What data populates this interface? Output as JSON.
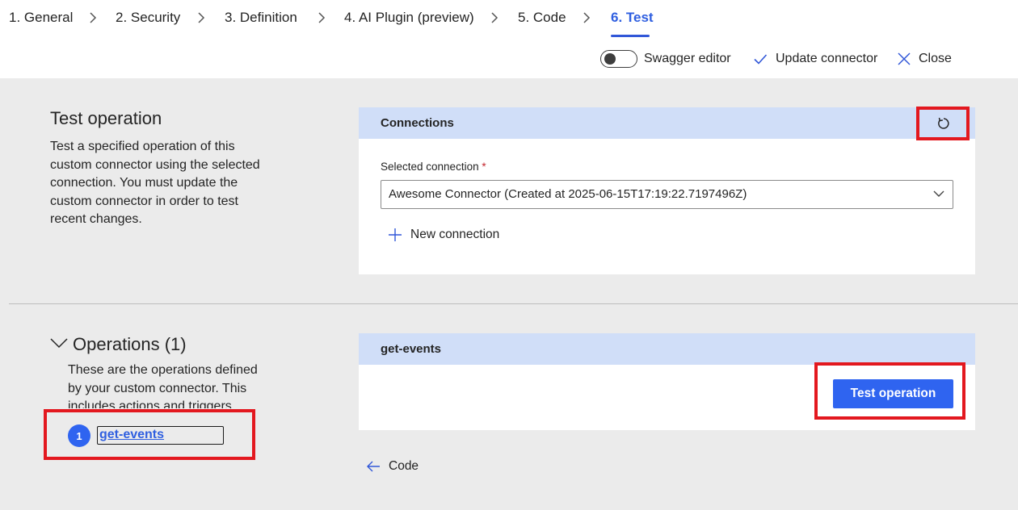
{
  "steps": [
    {
      "label": "1. General"
    },
    {
      "label": "2. Security"
    },
    {
      "label": "3. Definition"
    },
    {
      "label": "4. AI Plugin (preview)"
    },
    {
      "label": "5. Code"
    },
    {
      "label": "6. Test"
    }
  ],
  "toolbar": {
    "swagger_label": "Swagger editor",
    "update_label": "Update connector",
    "close_label": "Close"
  },
  "test_operation": {
    "title": "Test operation",
    "description": "Test a specified operation of this custom connector using the selected connection. You must update the custom connector in order to test recent changes."
  },
  "connections": {
    "header": "Connections",
    "selected_label": "Selected connection",
    "required_mark": "*",
    "selected_value": "Awesome Connector (Created at 2025-06-15T17:19:22.7197496Z)",
    "new_connection_label": "New connection"
  },
  "operations": {
    "title": "Operations (1)",
    "description": "These are the operations defined by your custom connector. This includes actions and triggers",
    "items": [
      {
        "number": "1",
        "name": "get-events"
      }
    ]
  },
  "operation_panel": {
    "header": "get-events",
    "test_button_label": "Test operation"
  },
  "back_link": {
    "label": "Code"
  },
  "colors": {
    "accent": "#2f64f0",
    "header_bg": "#d0def8",
    "highlight": "#e3181f",
    "page_bg": "#ebebeb"
  }
}
